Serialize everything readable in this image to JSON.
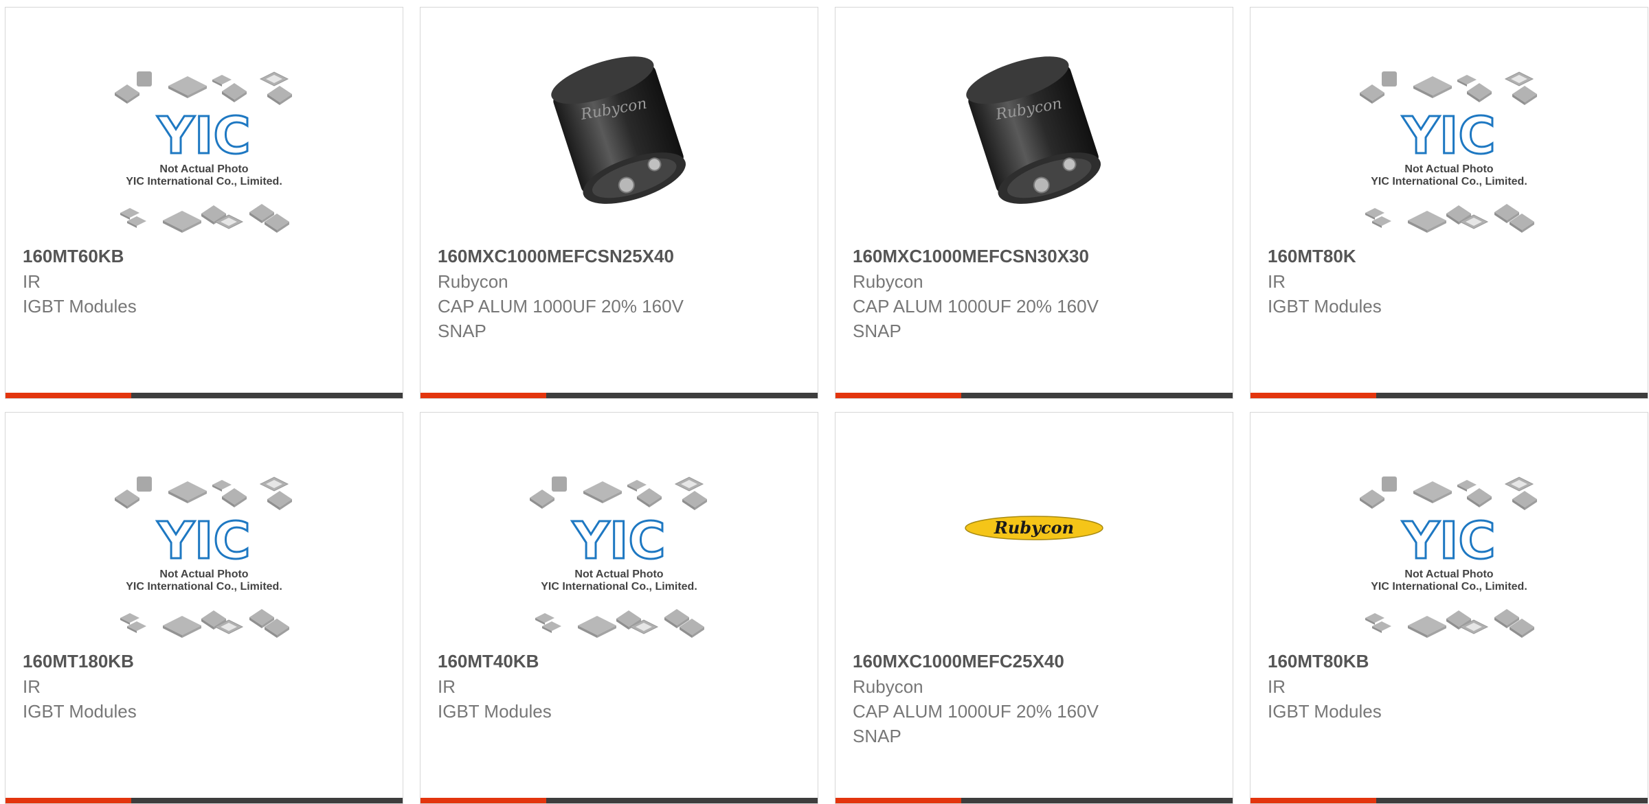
{
  "placeholder": {
    "logo_text": "YIC",
    "line1": "Not Actual Photo",
    "line2": "YIC International Co., Limited."
  },
  "rubycon_logo_text": "Rubycon",
  "capacitor_label": "Rubycon",
  "colors": {
    "accent": "#e3350e",
    "bar": "#3d3d3d",
    "border": "#d7d7d7",
    "part_number": "#555555",
    "text": "#777777",
    "yic_blue": "#1e78c2",
    "rubycon_yellow": "#f5c518"
  },
  "products": [
    {
      "part": "160MT60KB",
      "maker": "IR",
      "desc": "IGBT Modules",
      "image": "yic-placeholder"
    },
    {
      "part": "160MXC1000MEFCSN25X40",
      "maker": "Rubycon",
      "desc": "CAP ALUM 1000UF 20% 160V SNAP",
      "image": "capacitor"
    },
    {
      "part": "160MXC1000MEFCSN30X30",
      "maker": "Rubycon",
      "desc": "CAP ALUM 1000UF 20% 160V SNAP",
      "image": "capacitor"
    },
    {
      "part": "160MT80K",
      "maker": "IR",
      "desc": "IGBT Modules",
      "image": "yic-placeholder"
    },
    {
      "part": "160MT180KB",
      "maker": "IR",
      "desc": "IGBT Modules",
      "image": "yic-placeholder"
    },
    {
      "part": "160MT40KB",
      "maker": "IR",
      "desc": "IGBT Modules",
      "image": "yic-placeholder"
    },
    {
      "part": "160MXC1000MEFC25X40",
      "maker": "Rubycon",
      "desc": "CAP ALUM 1000UF 20% 160V SNAP",
      "image": "rubycon-logo"
    },
    {
      "part": "160MT80KB",
      "maker": "IR",
      "desc": "IGBT Modules",
      "image": "yic-placeholder"
    }
  ]
}
